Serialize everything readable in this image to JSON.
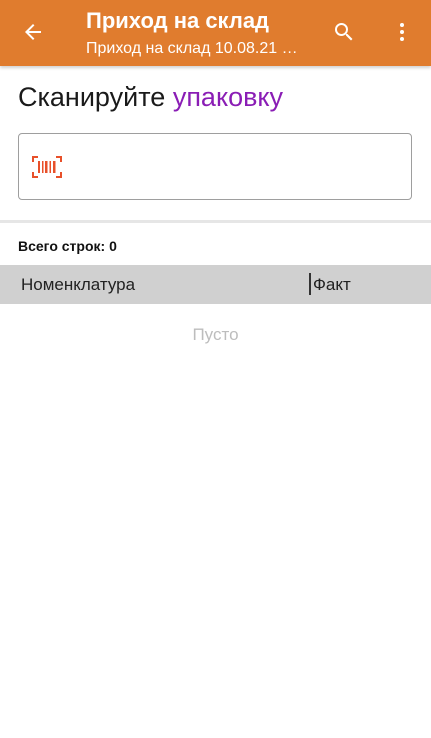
{
  "appbar": {
    "title": "Приход на склад",
    "subtitle": "Приход на склад 10.08.21 …",
    "icons": {
      "back": "arrow-back-icon",
      "search": "search-icon",
      "menu": "more-vert-icon"
    },
    "color": "#e07c2e"
  },
  "prompt": {
    "text": "Сканируйте",
    "accent_text": "упаковку",
    "accent_color": "#8a1db5"
  },
  "scan_field": {
    "value": "",
    "icon": "barcode-icon",
    "icon_color": "#e8502a"
  },
  "summary": {
    "total_rows": "Всего строк: 0"
  },
  "table": {
    "columns": [
      "Номенклатура",
      "Факт"
    ],
    "rows": [],
    "empty_text": "Пусто"
  }
}
